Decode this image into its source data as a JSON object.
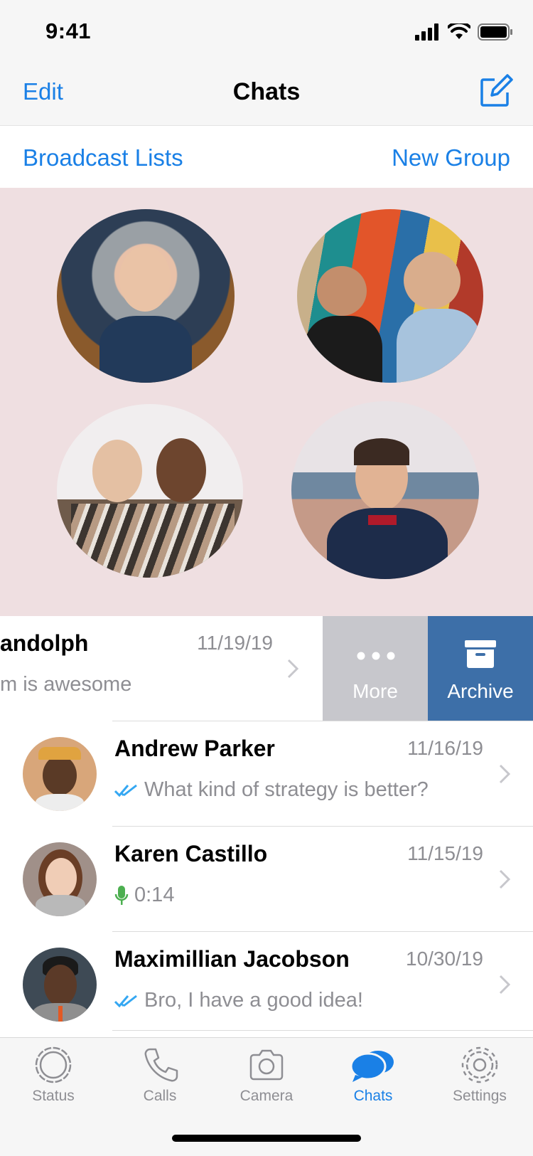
{
  "status_bar": {
    "time": "9:41"
  },
  "nav": {
    "edit": "Edit",
    "title": "Chats"
  },
  "subbar": {
    "broadcast": "Broadcast Lists",
    "new_group": "New Group"
  },
  "swiped_row": {
    "name": "andolph",
    "date": "11/19/19",
    "preview": "m is awesome",
    "more": "More",
    "archive": "Archive"
  },
  "chats": [
    {
      "name": "Andrew Parker",
      "date": "11/16/19",
      "preview": "What kind of strategy is better?",
      "icon": "double-check-icon"
    },
    {
      "name": "Karen Castillo",
      "date": "11/15/19",
      "preview": "0:14",
      "icon": "microphone-icon"
    },
    {
      "name": "Maximillian Jacobson",
      "date": "10/30/19",
      "preview": "Bro, I have a good idea!",
      "icon": "double-check-icon"
    }
  ],
  "tabs": [
    {
      "label": "Status",
      "icon": "status-icon"
    },
    {
      "label": "Calls",
      "icon": "phone-icon"
    },
    {
      "label": "Camera",
      "icon": "camera-icon"
    },
    {
      "label": "Chats",
      "icon": "chat-bubbles-icon",
      "active": true
    },
    {
      "label": "Settings",
      "icon": "gear-icon"
    }
  ],
  "colors": {
    "accent": "#1a80e6",
    "archive": "#3d6fa8",
    "more": "#c7c7cc",
    "photo_bg": "#efdfe1",
    "check": "#34a7f2",
    "mic": "#4caf50"
  }
}
